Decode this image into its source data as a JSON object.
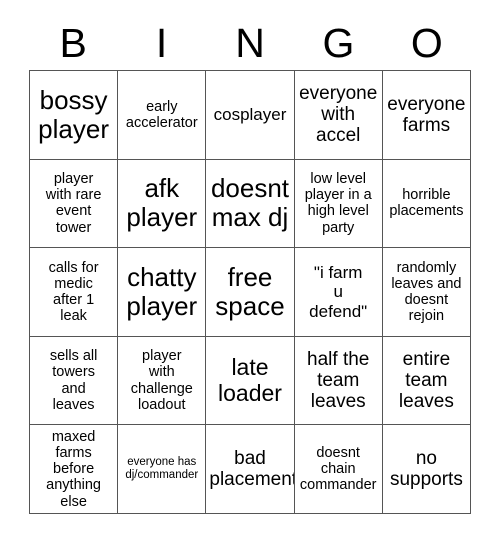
{
  "card": {
    "title": "BINGO",
    "header_letters": [
      "B",
      "I",
      "N",
      "G",
      "O"
    ],
    "border_color": "#555555",
    "background_color": "#ffffff",
    "text_color": "#000000",
    "columns": 5,
    "rows": 5,
    "cells": [
      {
        "text": "bossy\nplayer",
        "size": "xl",
        "column": "B",
        "row": 1
      },
      {
        "text": "early\naccelerator",
        "size": "xs",
        "column": "I",
        "row": 1
      },
      {
        "text": "cosplayer",
        "size": "sm",
        "column": "N",
        "row": 1
      },
      {
        "text": "everyone\nwith\naccel",
        "size": "md",
        "column": "G",
        "row": 1
      },
      {
        "text": "everyone\nfarms",
        "size": "md",
        "column": "O",
        "row": 1
      },
      {
        "text": "player\nwith rare\nevent\ntower",
        "size": "xs",
        "column": "B",
        "row": 2
      },
      {
        "text": "afk\nplayer",
        "size": "xl",
        "column": "I",
        "row": 2
      },
      {
        "text": "doesnt\nmax dj",
        "size": "xl",
        "column": "N",
        "row": 2
      },
      {
        "text": "low level\nplayer in a\nhigh level\nparty",
        "size": "xs",
        "column": "G",
        "row": 2
      },
      {
        "text": "horrible\nplacements",
        "size": "xs",
        "column": "O",
        "row": 2
      },
      {
        "text": "calls for\nmedic\nafter 1\nleak",
        "size": "xs",
        "column": "B",
        "row": 3
      },
      {
        "text": "chatty\nplayer",
        "size": "xl",
        "column": "I",
        "row": 3
      },
      {
        "text": "free\nspace",
        "size": "xl",
        "column": "N",
        "row": 3
      },
      {
        "text": "\"i farm\nu\ndefend\"",
        "size": "sm",
        "column": "G",
        "row": 3
      },
      {
        "text": "randomly\nleaves and\ndoesnt\nrejoin",
        "size": "xs",
        "column": "O",
        "row": 3
      },
      {
        "text": "sells all\ntowers\nand\nleaves",
        "size": "xs",
        "column": "B",
        "row": 4
      },
      {
        "text": "player\nwith\nchallenge\nloadout",
        "size": "xs",
        "column": "I",
        "row": 4
      },
      {
        "text": "late\nloader",
        "size": "lg",
        "column": "N",
        "row": 4
      },
      {
        "text": "half the\nteam\nleaves",
        "size": "md",
        "column": "G",
        "row": 4
      },
      {
        "text": "entire\nteam\nleaves",
        "size": "md",
        "column": "O",
        "row": 4
      },
      {
        "text": "maxed\nfarms before\nanything\nelse",
        "size": "xs",
        "column": "B",
        "row": 5
      },
      {
        "text": "everyone has\ndj/commander",
        "size": "xxs",
        "column": "I",
        "row": 5
      },
      {
        "text": "bad\nplacement",
        "size": "md",
        "column": "N",
        "row": 5
      },
      {
        "text": "doesnt\nchain\ncommander",
        "size": "xs",
        "column": "G",
        "row": 5
      },
      {
        "text": "no\nsupports",
        "size": "md",
        "column": "O",
        "row": 5
      }
    ]
  }
}
